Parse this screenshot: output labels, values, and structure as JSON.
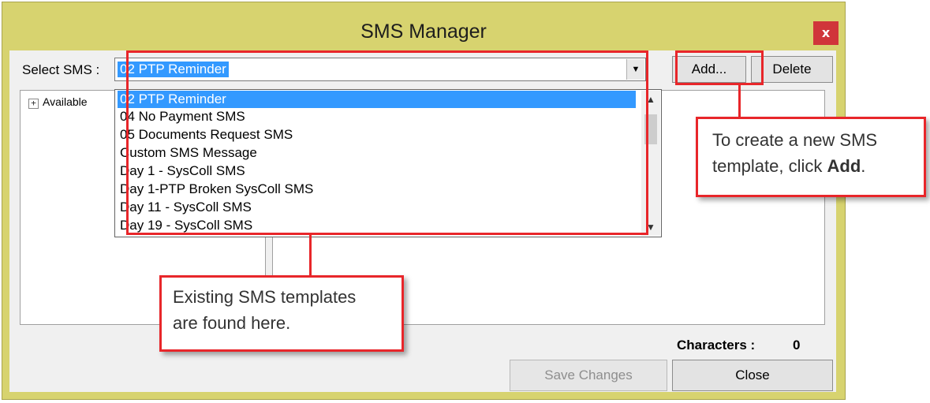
{
  "window": {
    "title": "SMS Manager",
    "close_glyph": "x"
  },
  "select_sms": {
    "label": "Select SMS :",
    "value": "02 PTP Reminder",
    "arrow_glyph": "▼"
  },
  "buttons": {
    "add": "Add...",
    "delete": "Delete",
    "save": "Save Changes",
    "close": "Close"
  },
  "tree": {
    "expander_glyph": "+",
    "root": "Available"
  },
  "dropdown_options": [
    "02 PTP Reminder",
    "04 No Payment SMS",
    "05 Documents Request SMS",
    "Custom SMS Message",
    "Day 1 - SysColl SMS",
    "Day 1-PTP Broken SysColl SMS",
    "Day 11 - SysColl SMS",
    "Day 19 - SysColl SMS"
  ],
  "characters": {
    "label": "Characters :",
    "count": "0"
  },
  "callouts": {
    "add_line1": "To create a new SMS",
    "add_line2_prefix": "template, click ",
    "add_line2_bold": "Add",
    "add_line2_suffix": ".",
    "list_line1": "Existing SMS templates",
    "list_line2": "are found here."
  },
  "colors": {
    "title_bar": "#d7d36f",
    "selection": "#3399ff",
    "annotation_red": "#e8262a",
    "close_button": "#d0353a"
  },
  "icons": [
    "close-icon",
    "dropdown-arrow-icon",
    "tree-expand-icon",
    "scroll-up-icon",
    "scroll-down-icon"
  ]
}
